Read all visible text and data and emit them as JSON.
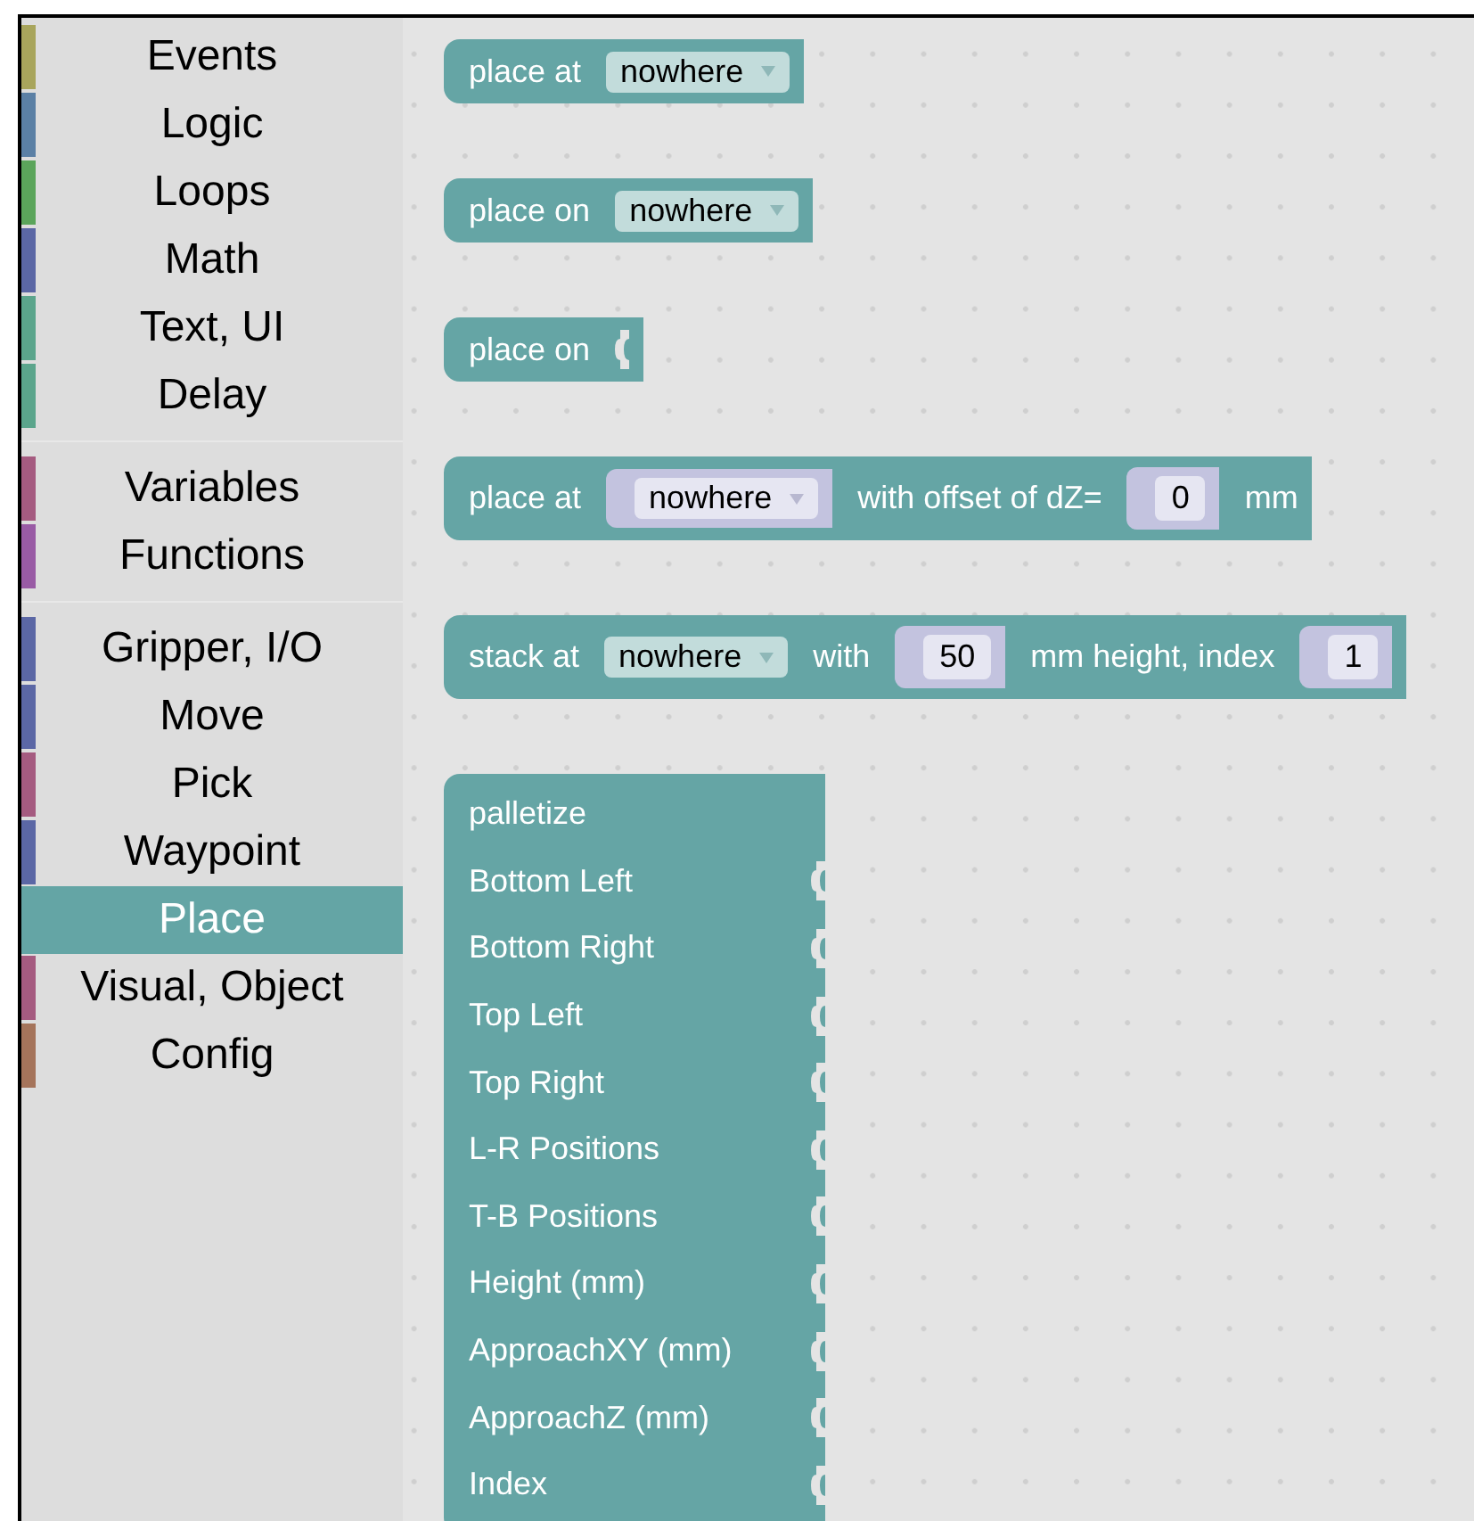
{
  "categories": [
    [
      {
        "label": "Events",
        "color": "#a8a55c",
        "selected": false
      },
      {
        "label": "Logic",
        "color": "#5b80a5",
        "selected": false
      },
      {
        "label": "Loops",
        "color": "#5ba55b",
        "selected": false
      },
      {
        "label": "Math",
        "color": "#5b67a5",
        "selected": false
      },
      {
        "label": "Text, UI",
        "color": "#5ba58c",
        "selected": false
      },
      {
        "label": "Delay",
        "color": "#5ba58c",
        "selected": false
      }
    ],
    [
      {
        "label": "Variables",
        "color": "#a55b80",
        "selected": false
      },
      {
        "label": "Functions",
        "color": "#995ba5",
        "selected": false
      }
    ],
    [
      {
        "label": "Gripper, I/O",
        "color": "#5b67a5",
        "selected": false
      },
      {
        "label": "Move",
        "color": "#5b67a5",
        "selected": false
      },
      {
        "label": "Pick",
        "color": "#a55b80",
        "selected": false
      },
      {
        "label": "Waypoint",
        "color": "#5b67a5",
        "selected": false
      },
      {
        "label": "Place",
        "selected": true
      },
      {
        "label": "Visual, Object",
        "color": "#a55b80",
        "selected": false
      },
      {
        "label": "Config",
        "color": "#a5745b",
        "selected": false
      }
    ]
  ],
  "blocks": [
    {
      "parts": [
        {
          "kind": "text",
          "text": "place at"
        },
        {
          "kind": "dropdown",
          "value": "nowhere"
        }
      ]
    },
    {
      "parts": [
        {
          "kind": "text",
          "text": "place on"
        },
        {
          "kind": "dropdown",
          "value": "nowhere"
        }
      ]
    },
    {
      "parts": [
        {
          "kind": "text",
          "text": "place on"
        },
        {
          "kind": "socket"
        }
      ]
    },
    {
      "parts": [
        {
          "kind": "text",
          "text": "place at"
        },
        {
          "kind": "socket_dropdown",
          "value": "nowhere"
        },
        {
          "kind": "text",
          "text": "with offset of dZ="
        },
        {
          "kind": "socket_number",
          "value": "0"
        },
        {
          "kind": "text",
          "text": "mm"
        }
      ]
    },
    {
      "parts": [
        {
          "kind": "text",
          "text": "stack at"
        },
        {
          "kind": "dropdown",
          "value": "nowhere"
        },
        {
          "kind": "text",
          "text": "with"
        },
        {
          "kind": "socket_number",
          "value": "50"
        },
        {
          "kind": "text",
          "text": "mm height, index"
        },
        {
          "kind": "socket_number",
          "value": "1"
        }
      ]
    }
  ],
  "palletize": {
    "title": "palletize",
    "inputs": [
      "Bottom Left",
      "Bottom Right",
      "Top Left",
      "Top Right",
      "L-R Positions",
      "T-B Positions",
      "Height (mm)",
      "ApproachXY (mm)",
      "ApproachZ (mm)",
      "Index"
    ]
  }
}
